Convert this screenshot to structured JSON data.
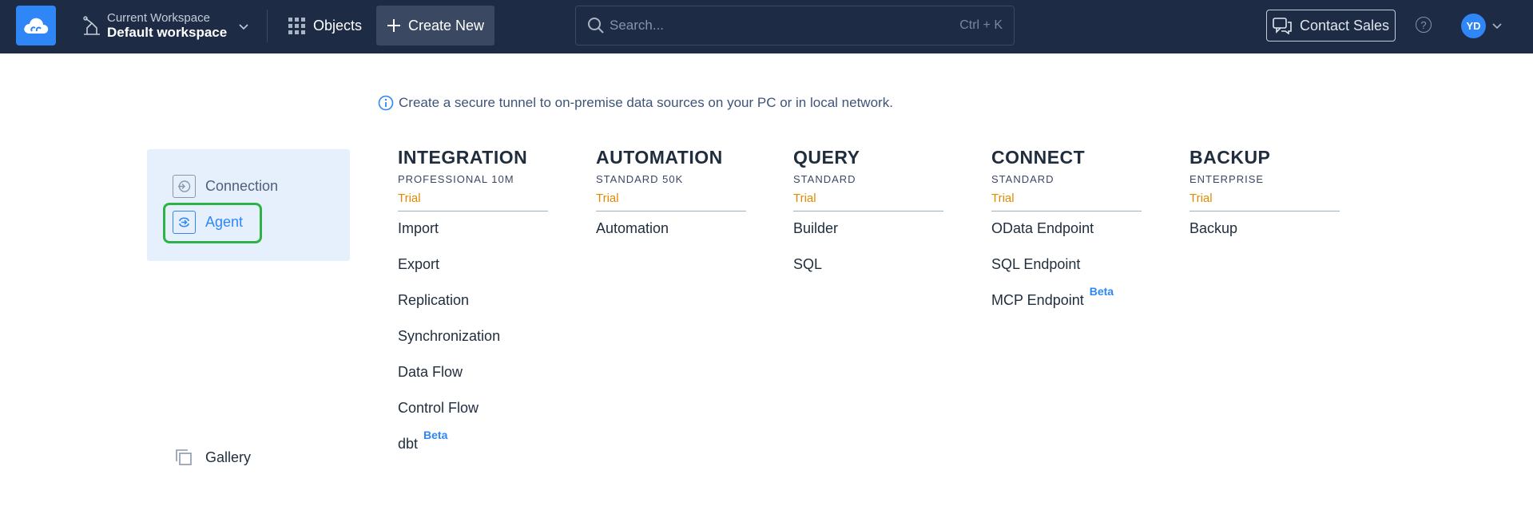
{
  "topbar": {
    "workspace_label": "Current Workspace",
    "workspace_name": "Default workspace",
    "objects_label": "Objects",
    "create_label": "Create New",
    "search_placeholder": "Search...",
    "search_shortcut": "Ctrl + K",
    "contact_label": "Contact Sales",
    "help_glyph": "?",
    "avatar_initials": "YD"
  },
  "info_text": "Create a secure tunnel to on-premise data sources on your PC or in local network.",
  "sidebar": {
    "items": [
      {
        "label": "Connection",
        "icon": "connection-icon"
      },
      {
        "label": "Agent",
        "icon": "agent-icon",
        "selected": true
      }
    ],
    "gallery_label": "Gallery"
  },
  "columns": [
    {
      "title": "INTEGRATION",
      "plan": "PROFESSIONAL 10M",
      "status": "Trial",
      "items": [
        {
          "label": "Import"
        },
        {
          "label": "Export"
        },
        {
          "label": "Replication"
        },
        {
          "label": "Synchronization"
        },
        {
          "label": "Data Flow"
        },
        {
          "label": "Control Flow"
        },
        {
          "label": "dbt",
          "badge": "Beta"
        }
      ]
    },
    {
      "title": "AUTOMATION",
      "plan": "STANDARD 50K",
      "status": "Trial",
      "items": [
        {
          "label": "Automation"
        }
      ]
    },
    {
      "title": "QUERY",
      "plan": "STANDARD",
      "status": "Trial",
      "items": [
        {
          "label": "Builder"
        },
        {
          "label": "SQL"
        }
      ]
    },
    {
      "title": "CONNECT",
      "plan": "STANDARD",
      "status": "Trial",
      "items": [
        {
          "label": "OData Endpoint"
        },
        {
          "label": "SQL Endpoint"
        },
        {
          "label": "MCP Endpoint",
          "badge": "Beta"
        }
      ]
    },
    {
      "title": "BACKUP",
      "plan": "ENTERPRISE",
      "status": "Trial",
      "items": [
        {
          "label": "Backup"
        }
      ]
    }
  ],
  "colors": {
    "topbar": "#1e2b45",
    "accent": "#2f86f6",
    "trial": "#e08a00",
    "selected_outline": "#2db345"
  }
}
